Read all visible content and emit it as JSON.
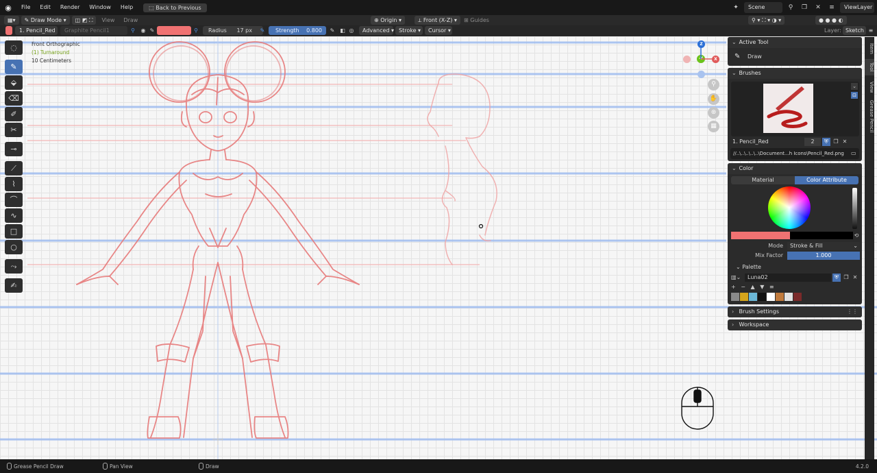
{
  "menubar": {
    "menus": [
      "File",
      "Edit",
      "Render",
      "Window",
      "Help"
    ],
    "back_button": "Back to Previous",
    "scene_name": "Scene",
    "view_layer": "ViewLayer"
  },
  "header1": {
    "mode": "Draw Mode",
    "view_menu": "View",
    "draw_menu": "Draw",
    "pivot": "Origin",
    "view_axis": "Front (X-Z)",
    "guides": "Guides"
  },
  "header2": {
    "material": "1. Pencil_Red",
    "layer_name": "Graphite Pencil1",
    "radius_label": "Radius",
    "radius_value": "17 px",
    "strength_label": "Strength",
    "strength_value": "0.800",
    "advanced": "Advanced",
    "stroke": "Stroke",
    "cursor": "Cursor",
    "layer_label": "Layer:",
    "layer_value": "Sketch",
    "stroke_color": "#f07272"
  },
  "viewport_info": {
    "line1": "Front Orthographic",
    "line2": "(1) Turnaround",
    "line3": "10 Centimeters"
  },
  "gizmo": {
    "z": "Z",
    "y": "-Y",
    "x": "X"
  },
  "tool_panel": {
    "active_tool_title": "Active Tool",
    "active_tool_name": "Draw",
    "brushes_title": "Brushes",
    "brush_name": "1. Pencil_Red",
    "brush_users": "2",
    "brush_path": "//..\\..\\..\\..\\..\\Document...h Icons\\Pencil_Red.png",
    "color_title": "Color",
    "tab_material": "Material",
    "tab_color_attribute": "Color Attribute",
    "mode_label": "Mode",
    "mode_value": "Stroke & Fill",
    "mix_factor_label": "Mix Factor",
    "mix_factor_value": "1.000",
    "palette_title": "Palette",
    "palette_name": "Luna02",
    "palette_colors": [
      "#8a8a8a",
      "#d4a51d",
      "#6bb7d6",
      "#111111",
      "#ffffff",
      "#c07a3c",
      "#e2e2e2",
      "#7a2a2a"
    ],
    "brush_settings_title": "Brush Settings",
    "workspace_title": "Workspace"
  },
  "side_tabs": [
    "Item",
    "Tool",
    "View",
    "Grease Pencil"
  ],
  "statusbar": {
    "item1": "Grease Pencil Draw",
    "item2": "Pan View",
    "item3": "Draw",
    "version": "4.2.0"
  }
}
